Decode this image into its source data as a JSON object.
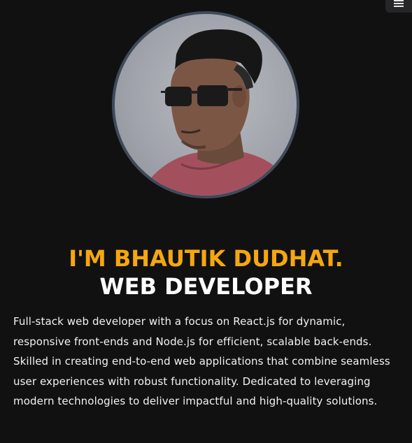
{
  "header": {
    "menu_icon": "menu-icon"
  },
  "profile": {
    "avatar_alt": "profile-photo",
    "name_line": "I'M BHAUTIK DUDHAT.",
    "role_line": "WEB DEVELOPER",
    "bio": "Full-stack web developer with a focus on React.js for dynamic, responsive front-ends and Node.js for efficient, scalable back-ends. Skilled in creating end-to-end web applications that combine seamless user experiences with robust functionality. Dedicated to leveraging modern technologies to deliver impactful and high-quality solutions."
  },
  "colors": {
    "background": "#121111",
    "accent": "#f5a70f",
    "heading": "#ffffff",
    "text": "#f2f2f2",
    "avatar_border": "#3f4a5a"
  }
}
